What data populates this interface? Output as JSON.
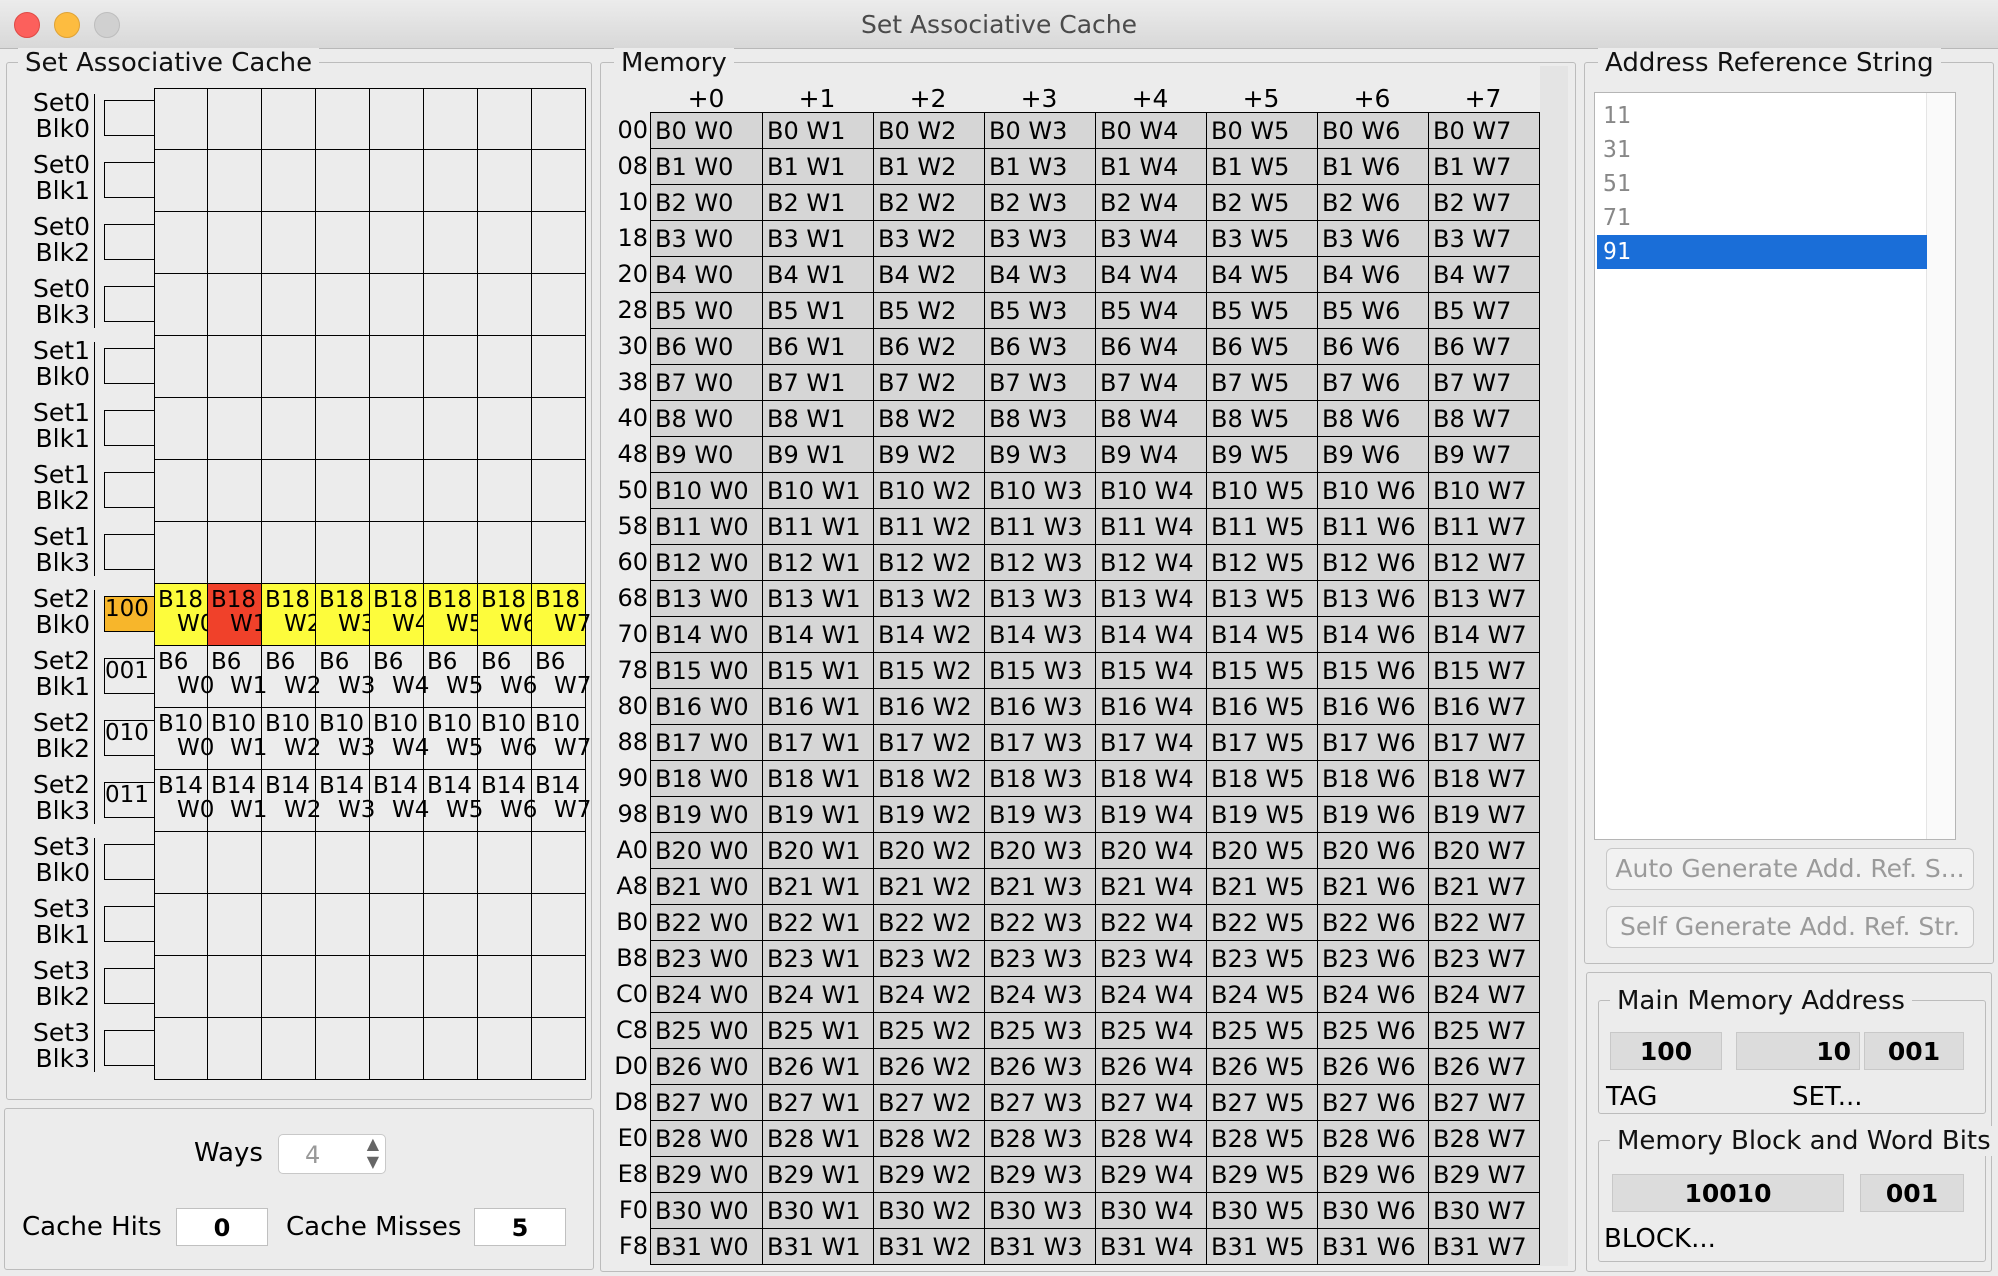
{
  "window": {
    "title": "Set Associative Cache"
  },
  "cache_panel": {
    "title": "Set Associative Cache",
    "rows": [
      {
        "set": "Set0",
        "blk": "Blk0",
        "tag": "",
        "cells": []
      },
      {
        "set": "Set0",
        "blk": "Blk1",
        "tag": "",
        "cells": []
      },
      {
        "set": "Set0",
        "blk": "Blk2",
        "tag": "",
        "cells": []
      },
      {
        "set": "Set0",
        "blk": "Blk3",
        "tag": "",
        "cells": []
      },
      {
        "set": "Set1",
        "blk": "Blk0",
        "tag": "",
        "cells": []
      },
      {
        "set": "Set1",
        "blk": "Blk1",
        "tag": "",
        "cells": []
      },
      {
        "set": "Set1",
        "blk": "Blk2",
        "tag": "",
        "cells": []
      },
      {
        "set": "Set1",
        "blk": "Blk3",
        "tag": "",
        "cells": []
      },
      {
        "set": "Set2",
        "blk": "Blk0",
        "tag": "100",
        "highlight": "yellow",
        "hit_col": 1,
        "cells": [
          [
            "B18",
            "W0"
          ],
          [
            "B18",
            "W1"
          ],
          [
            "B18",
            "W2"
          ],
          [
            "B18",
            "W3"
          ],
          [
            "B18",
            "W4"
          ],
          [
            "B18",
            "W5"
          ],
          [
            "B18",
            "W6"
          ],
          [
            "B18",
            "W7"
          ]
        ]
      },
      {
        "set": "Set2",
        "blk": "Blk1",
        "tag": "001",
        "cells": [
          [
            "B6",
            "W0"
          ],
          [
            "B6",
            "W1"
          ],
          [
            "B6",
            "W2"
          ],
          [
            "B6",
            "W3"
          ],
          [
            "B6",
            "W4"
          ],
          [
            "B6",
            "W5"
          ],
          [
            "B6",
            "W6"
          ],
          [
            "B6",
            "W7"
          ]
        ]
      },
      {
        "set": "Set2",
        "blk": "Blk2",
        "tag": "010",
        "cells": [
          [
            "B10",
            "W0"
          ],
          [
            "B10",
            "W1"
          ],
          [
            "B10",
            "W2"
          ],
          [
            "B10",
            "W3"
          ],
          [
            "B10",
            "W4"
          ],
          [
            "B10",
            "W5"
          ],
          [
            "B10",
            "W6"
          ],
          [
            "B10",
            "W7"
          ]
        ]
      },
      {
        "set": "Set2",
        "blk": "Blk3",
        "tag": "011",
        "cells": [
          [
            "B14",
            "W0"
          ],
          [
            "B14",
            "W1"
          ],
          [
            "B14",
            "W2"
          ],
          [
            "B14",
            "W3"
          ],
          [
            "B14",
            "W4"
          ],
          [
            "B14",
            "W5"
          ],
          [
            "B14",
            "W6"
          ],
          [
            "B14",
            "W7"
          ]
        ]
      },
      {
        "set": "Set3",
        "blk": "Blk0",
        "tag": "",
        "cells": []
      },
      {
        "set": "Set3",
        "blk": "Blk1",
        "tag": "",
        "cells": []
      },
      {
        "set": "Set3",
        "blk": "Blk2",
        "tag": "",
        "cells": []
      },
      {
        "set": "Set3",
        "blk": "Blk3",
        "tag": "",
        "cells": []
      }
    ]
  },
  "controls": {
    "ways_label": "Ways",
    "ways_value": "4",
    "hits_label": "Cache Hits",
    "hits_value": "0",
    "misses_label": "Cache Misses",
    "misses_value": "5"
  },
  "memory_panel": {
    "title": "Memory",
    "col_headers": [
      "+0",
      "+1",
      "+2",
      "+3",
      "+4",
      "+5",
      "+6",
      "+7"
    ],
    "row_addrs": [
      "00",
      "08",
      "10",
      "18",
      "20",
      "28",
      "30",
      "38",
      "40",
      "48",
      "50",
      "58",
      "60",
      "68",
      "70",
      "78",
      "80",
      "88",
      "90",
      "98",
      "A0",
      "A8",
      "B0",
      "B8",
      "C0",
      "C8",
      "D0",
      "D8",
      "E0",
      "E8",
      "F0",
      "F8"
    ],
    "cells": [
      [
        "B0 W0",
        "B0 W1",
        "B0 W2",
        "B0 W3",
        "B0 W4",
        "B0 W5",
        "B0 W6",
        "B0 W7"
      ],
      [
        "B1 W0",
        "B1 W1",
        "B1 W2",
        "B1 W3",
        "B1 W4",
        "B1 W5",
        "B1 W6",
        "B1 W7"
      ],
      [
        "B2 W0",
        "B2 W1",
        "B2 W2",
        "B2 W3",
        "B2 W4",
        "B2 W5",
        "B2 W6",
        "B2 W7"
      ],
      [
        "B3 W0",
        "B3 W1",
        "B3 W2",
        "B3 W3",
        "B3 W4",
        "B3 W5",
        "B3 W6",
        "B3 W7"
      ],
      [
        "B4 W0",
        "B4 W1",
        "B4 W2",
        "B4 W3",
        "B4 W4",
        "B4 W5",
        "B4 W6",
        "B4 W7"
      ],
      [
        "B5 W0",
        "B5 W1",
        "B5 W2",
        "B5 W3",
        "B5 W4",
        "B5 W5",
        "B5 W6",
        "B5 W7"
      ],
      [
        "B6 W0",
        "B6 W1",
        "B6 W2",
        "B6 W3",
        "B6 W4",
        "B6 W5",
        "B6 W6",
        "B6 W7"
      ],
      [
        "B7 W0",
        "B7 W1",
        "B7 W2",
        "B7 W3",
        "B7 W4",
        "B7 W5",
        "B7 W6",
        "B7 W7"
      ],
      [
        "B8 W0",
        "B8 W1",
        "B8 W2",
        "B8 W3",
        "B8 W4",
        "B8 W5",
        "B8 W6",
        "B8 W7"
      ],
      [
        "B9 W0",
        "B9 W1",
        "B9 W2",
        "B9 W3",
        "B9 W4",
        "B9 W5",
        "B9 W6",
        "B9 W7"
      ],
      [
        "B10 W0",
        "B10 W1",
        "B10 W2",
        "B10 W3",
        "B10 W4",
        "B10 W5",
        "B10 W6",
        "B10 W7"
      ],
      [
        "B11 W0",
        "B11 W1",
        "B11 W2",
        "B11 W3",
        "B11 W4",
        "B11 W5",
        "B11 W6",
        "B11 W7"
      ],
      [
        "B12 W0",
        "B12 W1",
        "B12 W2",
        "B12 W3",
        "B12 W4",
        "B12 W5",
        "B12 W6",
        "B12 W7"
      ],
      [
        "B13 W0",
        "B13 W1",
        "B13 W2",
        "B13 W3",
        "B13 W4",
        "B13 W5",
        "B13 W6",
        "B13 W7"
      ],
      [
        "B14 W0",
        "B14 W1",
        "B14 W2",
        "B14 W3",
        "B14 W4",
        "B14 W5",
        "B14 W6",
        "B14 W7"
      ],
      [
        "B15 W0",
        "B15 W1",
        "B15 W2",
        "B15 W3",
        "B15 W4",
        "B15 W5",
        "B15 W6",
        "B15 W7"
      ],
      [
        "B16 W0",
        "B16 W1",
        "B16 W2",
        "B16 W3",
        "B16 W4",
        "B16 W5",
        "B16 W6",
        "B16 W7"
      ],
      [
        "B17 W0",
        "B17 W1",
        "B17 W2",
        "B17 W3",
        "B17 W4",
        "B17 W5",
        "B17 W6",
        "B17 W7"
      ],
      [
        "B18 W0",
        "B18 W1",
        "B18 W2",
        "B18 W3",
        "B18 W4",
        "B18 W5",
        "B18 W6",
        "B18 W7"
      ],
      [
        "B19 W0",
        "B19 W1",
        "B19 W2",
        "B19 W3",
        "B19 W4",
        "B19 W5",
        "B19 W6",
        "B19 W7"
      ],
      [
        "B20 W0",
        "B20 W1",
        "B20 W2",
        "B20 W3",
        "B20 W4",
        "B20 W5",
        "B20 W6",
        "B20 W7"
      ],
      [
        "B21 W0",
        "B21 W1",
        "B21 W2",
        "B21 W3",
        "B21 W4",
        "B21 W5",
        "B21 W6",
        "B21 W7"
      ],
      [
        "B22 W0",
        "B22 W1",
        "B22 W2",
        "B22 W3",
        "B22 W4",
        "B22 W5",
        "B22 W6",
        "B22 W7"
      ],
      [
        "B23 W0",
        "B23 W1",
        "B23 W2",
        "B23 W3",
        "B23 W4",
        "B23 W5",
        "B23 W6",
        "B23 W7"
      ],
      [
        "B24 W0",
        "B24 W1",
        "B24 W2",
        "B24 W3",
        "B24 W4",
        "B24 W5",
        "B24 W6",
        "B24 W7"
      ],
      [
        "B25 W0",
        "B25 W1",
        "B25 W2",
        "B25 W3",
        "B25 W4",
        "B25 W5",
        "B25 W6",
        "B25 W7"
      ],
      [
        "B26 W0",
        "B26 W1",
        "B26 W2",
        "B26 W3",
        "B26 W4",
        "B26 W5",
        "B26 W6",
        "B26 W7"
      ],
      [
        "B27 W0",
        "B27 W1",
        "B27 W2",
        "B27 W3",
        "B27 W4",
        "B27 W5",
        "B27 W6",
        "B27 W7"
      ],
      [
        "B28 W0",
        "B28 W1",
        "B28 W2",
        "B28 W3",
        "B28 W4",
        "B28 W5",
        "B28 W6",
        "B28 W7"
      ],
      [
        "B29 W0",
        "B29 W1",
        "B29 W2",
        "B29 W3",
        "B29 W4",
        "B29 W5",
        "B29 W6",
        "B29 W7"
      ],
      [
        "B30 W0",
        "B30 W1",
        "B30 W2",
        "B30 W3",
        "B30 W4",
        "B30 W5",
        "B30 W6",
        "B30 W7"
      ],
      [
        "B31 W0",
        "B31 W1",
        "B31 W2",
        "B31 W3",
        "B31 W4",
        "B31 W5",
        "B31 W6",
        "B31 W7"
      ]
    ]
  },
  "address_panel": {
    "title": "Address Reference String",
    "items": [
      "11",
      "31",
      "51",
      "71",
      "91"
    ],
    "selected_index": 4,
    "auto_button": "Auto Generate Add. Ref. S...",
    "self_button": "Self Generate Add. Ref. Str."
  },
  "main_memory_address": {
    "title": "Main Memory Address",
    "tag_value": "100",
    "set_value": "10",
    "word_value": "001",
    "tag_label": "TAG",
    "set_label": "SET..."
  },
  "block_word_bits": {
    "title": "Memory Block and Word Bits",
    "block_value": "10010",
    "word_value": "001",
    "block_label": "BLOCK..."
  },
  "colors": {
    "accent": "#1a6ed8",
    "hit_cell": "#f0412a",
    "active_row": "#fdfc3c",
    "active_tag": "#f7b62b"
  }
}
